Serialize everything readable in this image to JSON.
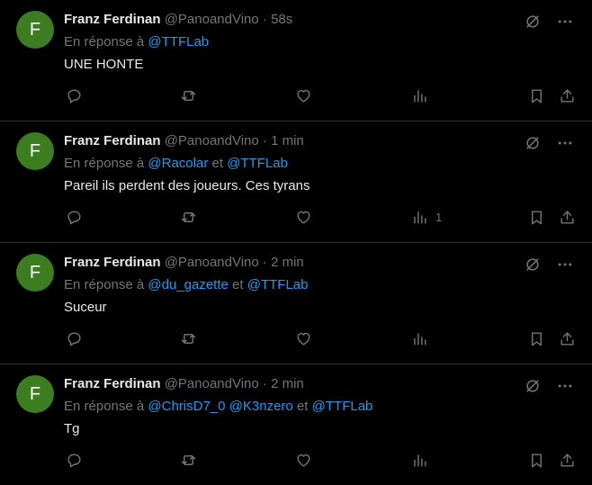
{
  "tweets": [
    {
      "avatar": "F",
      "name": "Franz Ferdinan",
      "handle": "@PanoandVino",
      "dot": "·",
      "time": "58s",
      "reply_prefix": "En réponse à",
      "mentions": [
        "@TTFLab"
      ],
      "text": "UNE HONTE",
      "views": ""
    },
    {
      "avatar": "F",
      "name": "Franz Ferdinan",
      "handle": "@PanoandVino",
      "dot": "·",
      "time": "1 min",
      "reply_prefix": "En réponse à",
      "mentions": [
        "@Racolar",
        "@TTFLab"
      ],
      "separators": [
        "et"
      ],
      "text": "Pareil ils perdent des joueurs. Ces tyrans",
      "views": "1"
    },
    {
      "avatar": "F",
      "name": "Franz Ferdinan",
      "handle": "@PanoandVino",
      "dot": "·",
      "time": "2 min",
      "reply_prefix": "En réponse à",
      "mentions": [
        "@du_gazette",
        "@TTFLab"
      ],
      "separators": [
        "et"
      ],
      "text": "Suceur",
      "views": ""
    },
    {
      "avatar": "F",
      "name": "Franz Ferdinan",
      "handle": "@PanoandVino",
      "dot": "·",
      "time": "2 min",
      "reply_prefix": "En réponse à",
      "mentions": [
        "@ChrisD7_0",
        "@K3nzero",
        "@TTFLab"
      ],
      "separators": [
        "",
        "et"
      ],
      "text": "Tg",
      "views": ""
    }
  ],
  "icons": {
    "grok": "grok-icon",
    "more": "more-icon",
    "reply": "reply-icon",
    "retweet": "retweet-icon",
    "like": "like-icon",
    "views": "views-icon",
    "bookmark": "bookmark-icon",
    "share": "share-icon"
  },
  "colors": {
    "background": "#000000",
    "text": "#e7e9ea",
    "muted": "#71767b",
    "mention": "#1d9bf0",
    "avatar": "#3b7d1f",
    "border": "#2f3336"
  }
}
